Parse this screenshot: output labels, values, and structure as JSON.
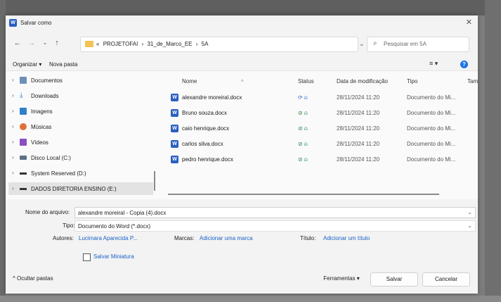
{
  "window": {
    "title": "Salvar como",
    "app_icon_letter": "W"
  },
  "address": {
    "crumbs": [
      "«",
      "PROJETOFAI",
      "›",
      "31_de_Marco_EE",
      "›",
      "5A"
    ],
    "search_placeholder": "Pesquisar em 5A"
  },
  "toolbar": {
    "organize_label": "Organizar ▾",
    "new_folder_label": "Nova pasta",
    "help_glyph": "?"
  },
  "sidebar": {
    "items": [
      {
        "label": "Documentos",
        "icon": "documents-icon"
      },
      {
        "label": "Downloads",
        "icon": "download-icon"
      },
      {
        "label": "Imagens",
        "icon": "images-icon"
      },
      {
        "label": "Músicas",
        "icon": "music-icon"
      },
      {
        "label": "Vídeos",
        "icon": "videos-icon"
      },
      {
        "label": "Disco Local (C:)",
        "icon": "drive-icon"
      },
      {
        "label": "System Reserved (D:)",
        "icon": "drive-icon"
      },
      {
        "label": "DADOS DIRETORIA ENSINO (E:)",
        "icon": "drive-icon",
        "selected": true
      }
    ]
  },
  "files": {
    "columns": [
      "Nome",
      "Status",
      "Data de modificação",
      "Tipo",
      "Tam"
    ],
    "rows": [
      {
        "name": "alexandre moreiral.docx",
        "status": "⟳ ⍝",
        "date": "28/11/2024 11:20",
        "type": "Documento do Mi..."
      },
      {
        "name": "Bruno souza.docx",
        "status": "⊘ ⍝",
        "date": "28/11/2024 11:20",
        "type": "Documento do Mi..."
      },
      {
        "name": "caio henrique.docx",
        "status": "⊘ ⍝",
        "date": "28/11/2024 11:20",
        "type": "Documento do Mi..."
      },
      {
        "name": "carlos silva.docx",
        "status": "⊘ ⍝",
        "date": "28/11/2024 11:20",
        "type": "Documento do Mi..."
      },
      {
        "name": "pedro henrique.docx",
        "status": "⊘ ⍝",
        "date": "28/11/2024 11:20",
        "type": "Documento do Mi..."
      }
    ]
  },
  "form": {
    "filename_label": "Nome do arquivo:",
    "filename_value": "alexandre moreiral - Copia (4).docx",
    "type_label": "Tipo:",
    "type_value": "Documento do Word (*.docx)",
    "authors_label": "Autores:",
    "authors_value": "Lucimara Aparecida P...",
    "tags_label": "Marcas:",
    "tags_value": "Adicionar uma marca",
    "title_label": "Título:",
    "title_value": "Adicionar um título",
    "thumbnail_label": "Salvar Miniatura"
  },
  "footer": {
    "hide_folders_label": "Ocultar pastas",
    "tools_label": "Ferramentas",
    "save_label": "Salvar",
    "cancel_label": "Cancelar"
  },
  "colors": {
    "accent": "#1a62c9",
    "word_blue": "#2b5fc1",
    "folder_yellow": "#f2c451",
    "sync_ok": "#2f8f4f"
  }
}
